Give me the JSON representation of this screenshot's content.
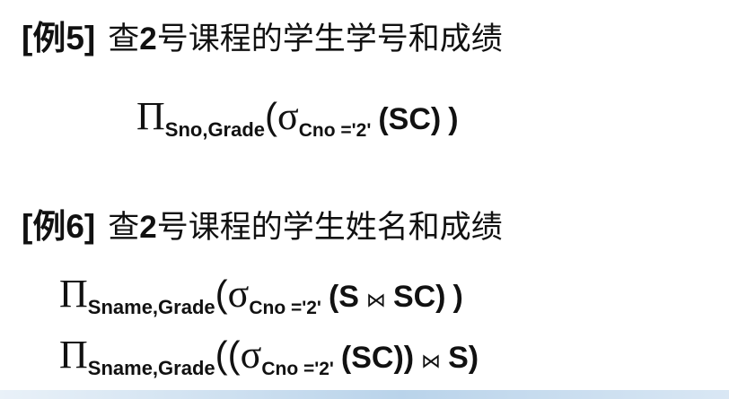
{
  "example5": {
    "tag": "[例5]",
    "title_pre": "查",
    "title_num": "2",
    "title_post": "号课程的学生学号和成绩",
    "formula": {
      "pi": "Π",
      "pi_sub": "Sno,Grade",
      "open": "(",
      "sigma": "σ",
      "sigma_sub": "Cno ='2'",
      "operand": "(SC)",
      "close": ")"
    }
  },
  "example6": {
    "tag": "[例6]",
    "title_pre": "查",
    "title_num": "2",
    "title_post": "号课程的学生姓名和成绩",
    "formula1": {
      "pi": "Π",
      "pi_sub": "Sname,Grade",
      "open": "(",
      "sigma": "σ",
      "sigma_sub": "Cno ='2'",
      "operand": "(S",
      "join": "⋈",
      "operand2": "SC)",
      "close": ")"
    },
    "formula2": {
      "pi": "Π",
      "pi_sub": "Sname,Grade",
      "open": "((",
      "sigma": "σ",
      "sigma_sub": "Cno ='2'",
      "operand": "(SC))",
      "join": "⋈",
      "operand2": "S)"
    }
  }
}
